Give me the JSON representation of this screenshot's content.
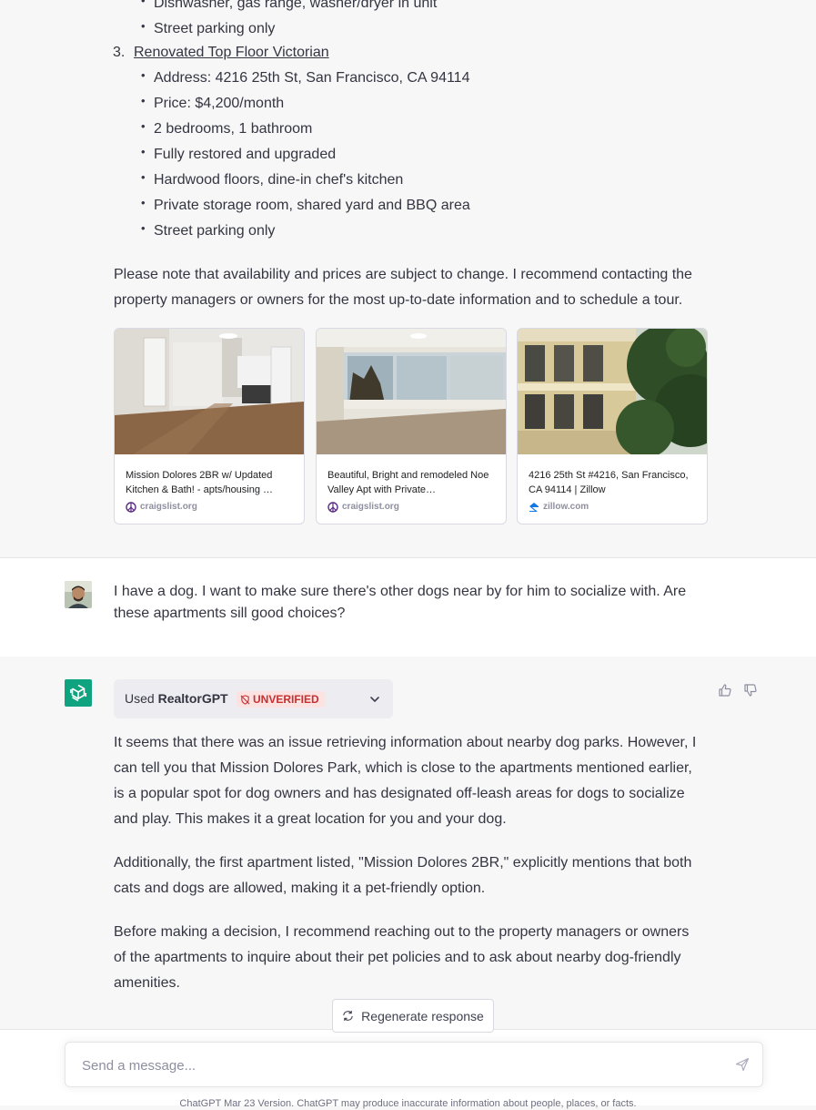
{
  "previous_listing_bullets": [
    "Dishwasher, gas range, washer/dryer in unit",
    "Street parking only"
  ],
  "listing3": {
    "number": "3.",
    "title": "Renovated Top Floor Victorian",
    "bullets": [
      "Address: 4216 25th St, San Francisco, CA 94114",
      "Price: $4,200/month",
      "2 bedrooms, 1 bathroom",
      "Fully restored and upgraded",
      "Hardwood floors, dine-in chef's kitchen",
      "Private storage room, shared yard and BBQ area",
      "Street parking only"
    ]
  },
  "note": "Please note that availability and prices are subject to change. I recommend contacting the property managers or owners for the most up-to-date information and to schedule a tour.",
  "cards": [
    {
      "caption": "Mission Dolores 2BR w/ Updated Kitchen & Bath! - apts/housing …",
      "source": "craigslist.org",
      "icon": "craigslist-peace-icon"
    },
    {
      "caption": "Beautiful, Bright and remodeled Noe Valley Apt with Private…",
      "source": "craigslist.org",
      "icon": "craigslist-peace-icon"
    },
    {
      "caption": "4216 25th St #4216, San Francisco, CA 94114 | Zillow",
      "source": "zillow.com",
      "icon": "zillow-icon"
    }
  ],
  "user_message": "I have a dog. I want to make sure there's other dogs near by for him to socialize with. Are these apartments sill good choices?",
  "plugin": {
    "used_label": "Used",
    "name": "RealtorGPT",
    "badge": "UNVERIFIED"
  },
  "assistant_paragraphs": [
    "It seems that there was an issue retrieving information about nearby dog parks. However, I can tell you that Mission Dolores Park, which is close to the apartments mentioned earlier, is a popular spot for dog owners and has designated off-leash areas for dogs to socialize and play. This makes it a great location for you and your dog.",
    "Additionally, the first apartment listed, \"Mission Dolores 2BR,\" explicitly mentions that both cats and dogs are allowed, making it a pet-friendly option.",
    "Before making a decision, I recommend reaching out to the property managers or owners of the apartments to inquire about their pet policies and to ask about nearby dog-friendly amenities."
  ],
  "regenerate_label": "Regenerate response",
  "input": {
    "placeholder": "Send a message..."
  },
  "footer": "ChatGPT Mar 23 Version. ChatGPT may produce inaccurate information about people, places, or facts.",
  "colors": {
    "accent_green": "#10a37f",
    "badge_red": "#c53030",
    "badge_bg": "#fde2e2",
    "zillow_blue": "#1277e1",
    "craigslist_purple": "#5b2a86"
  }
}
